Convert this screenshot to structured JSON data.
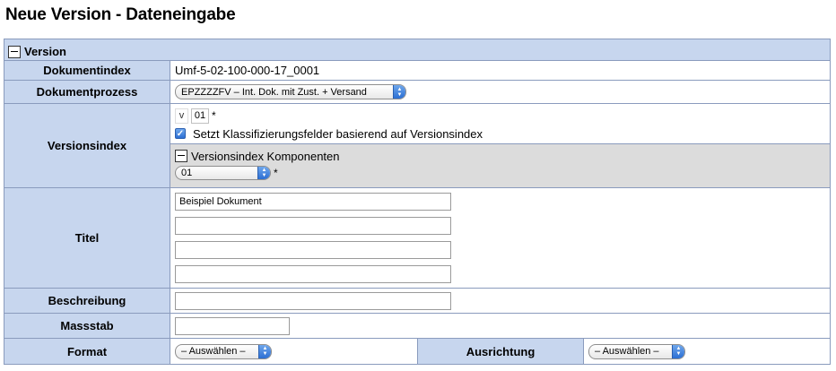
{
  "page": {
    "title": "Neue Version - Dateneingabe"
  },
  "section": {
    "title": "Version"
  },
  "fields": {
    "dokumentindex": {
      "label": "Dokumentindex",
      "value": "Umf-5-02-100-000-17_0001"
    },
    "dokumentprozess": {
      "label": "Dokumentprozess",
      "selected": "EPZZZZFV – Int. Dok. mit Zust. + Versand"
    },
    "versionsindex": {
      "label": "Versionsindex",
      "prefix": "v",
      "value": "01",
      "required_mark": "*",
      "checkbox_label": "Setzt Klassifizierungsfelder basierend auf Versionsindex",
      "checkbox_checked": true,
      "komponenten": {
        "title": "Versionsindex Komponenten",
        "selected": "01",
        "required_mark": "*"
      }
    },
    "titel": {
      "label": "Titel",
      "lines": [
        "Beispiel Dokument",
        "",
        "",
        ""
      ]
    },
    "beschreibung": {
      "label": "Beschreibung",
      "value": ""
    },
    "massstab": {
      "label": "Massstab",
      "value": ""
    },
    "format": {
      "label": "Format",
      "selected": "– Auswählen –"
    },
    "ausrichtung": {
      "label": "Ausrichtung",
      "selected": "– Auswählen –"
    }
  },
  "icons": {
    "collapse": "minus-box-icon",
    "select_arrows": "updown-arrows-icon",
    "check": "checkmark-icon"
  },
  "colors": {
    "label_bg": "#c7d6ee",
    "border": "#8a9bbd",
    "subpanel_bg": "#dcdcdc",
    "accent": "#2b6ed3"
  }
}
